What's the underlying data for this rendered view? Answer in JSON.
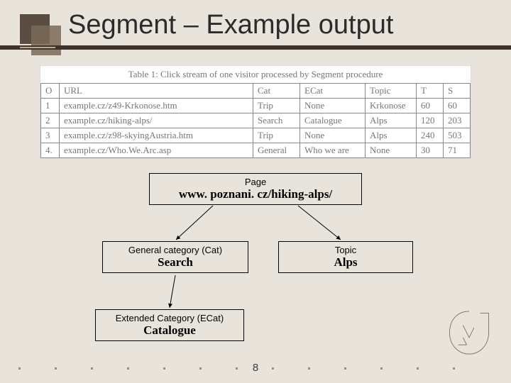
{
  "slide": {
    "title": "Segment – Example output",
    "page_number": "8"
  },
  "table": {
    "caption": "Table 1: Click stream of one visitor processed by Segment procedure",
    "headers": {
      "o": "O",
      "url": "URL",
      "cat": "Cat",
      "ecat": "ECat",
      "topic": "Topic",
      "t": "T",
      "s": "S"
    },
    "rows": [
      {
        "o": "1",
        "url": "example.cz/z49-Krkonose.htm",
        "cat": "Trip",
        "ecat": "None",
        "topic": "Krkonose",
        "t": "60",
        "s": "60"
      },
      {
        "o": "2",
        "url": "example.cz/hiking-alps/",
        "cat": "Search",
        "ecat": "Catalogue",
        "topic": "Alps",
        "t": "120",
        "s": "203"
      },
      {
        "o": "3",
        "url": "example.cz/z98-skyingAustria.htm",
        "cat": "Trip",
        "ecat": "None",
        "topic": "Alps",
        "t": "240",
        "s": "503"
      },
      {
        "o": "4.",
        "url": "example.cz/Who.We.Arc.asp",
        "cat": "General",
        "ecat": "Who we are",
        "topic": "None",
        "t": "30",
        "s": "71"
      }
    ]
  },
  "diagram": {
    "page": {
      "sup": "Page",
      "main": "www. poznani. cz/hiking-alps/"
    },
    "cat": {
      "sup": "General category (Cat)",
      "main": "Search"
    },
    "topic": {
      "sup": "Topic",
      "main": "Alps"
    },
    "ecat": {
      "sup": "Extended Category (ECat)",
      "main": "Catalogue"
    }
  }
}
